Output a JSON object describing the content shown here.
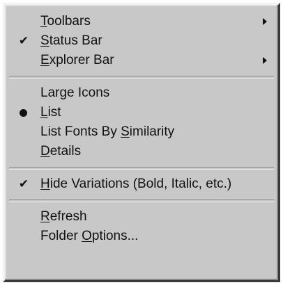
{
  "menu": {
    "items": [
      {
        "pre": "",
        "acc": "T",
        "post": "oolbars"
      },
      {
        "pre": "",
        "acc": "S",
        "post": "tatus Bar"
      },
      {
        "pre": "",
        "acc": "E",
        "post": "xplorer Bar"
      },
      {
        "pre": "Large Icons",
        "acc": "",
        "post": ""
      },
      {
        "pre": "",
        "acc": "L",
        "post": "ist"
      },
      {
        "pre": "List Fonts By ",
        "acc": "S",
        "post": "imilarity"
      },
      {
        "pre": "",
        "acc": "D",
        "post": "etails"
      },
      {
        "pre": "",
        "acc": "H",
        "post": "ide Variations (Bold, Italic, etc.)"
      },
      {
        "pre": "",
        "acc": "R",
        "post": "efresh"
      },
      {
        "pre": "Folder ",
        "acc": "O",
        "post": "ptions..."
      }
    ],
    "check_glyph": "✔",
    "icons": {
      "submenu": "submenu-arrow-icon",
      "check": "checkmark-icon",
      "radio": "radio-bullet-icon"
    }
  }
}
